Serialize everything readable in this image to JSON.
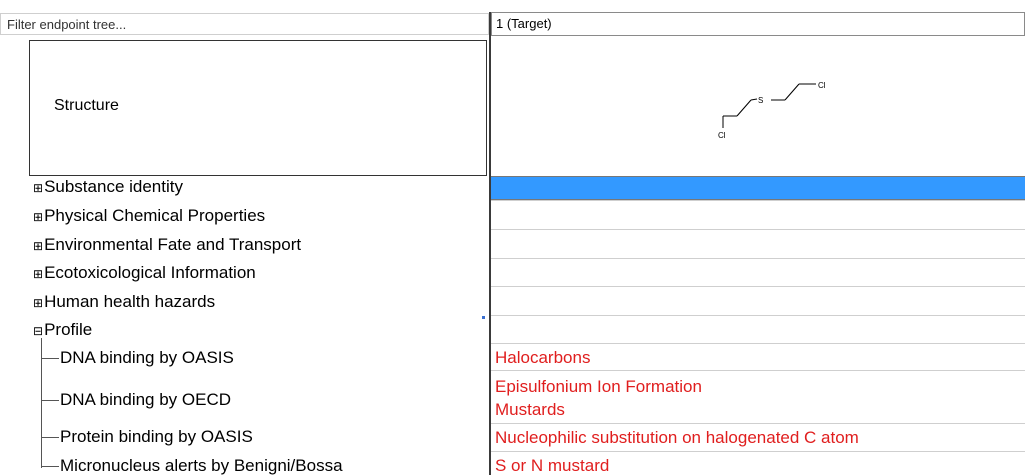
{
  "filter": {
    "placeholder": "Filter endpoint tree..."
  },
  "column": {
    "header": "1 (Target)"
  },
  "structure": {
    "label": "Structure",
    "atoms": {
      "s": "S",
      "cl_top": "Cl",
      "cl_bottom": "Cl"
    }
  },
  "tree": {
    "expand_glyph": "⊞",
    "collapse_glyph": "⊟",
    "items": [
      {
        "label": "Substance identity"
      },
      {
        "label": "Physical Chemical Properties"
      },
      {
        "label": "Environmental Fate and Transport"
      },
      {
        "label": "Ecotoxicological Information"
      },
      {
        "label": "Human health hazards"
      },
      {
        "label": "Profile"
      }
    ],
    "children": [
      {
        "label": "DNA binding by OASIS"
      },
      {
        "label": "DNA binding by OECD"
      },
      {
        "label": "Protein binding by OASIS"
      },
      {
        "label": "Micronucleus alerts by Benigni/Bossa"
      }
    ]
  },
  "values": [
    "Halocarbons",
    "Episulfonium Ion Formation",
    "Mustards",
    "Nucleophilic substitution on halogenated C atom",
    "S or N mustard"
  ],
  "colors": {
    "selection": "#3399ff",
    "value_text": "#e01e1e"
  }
}
